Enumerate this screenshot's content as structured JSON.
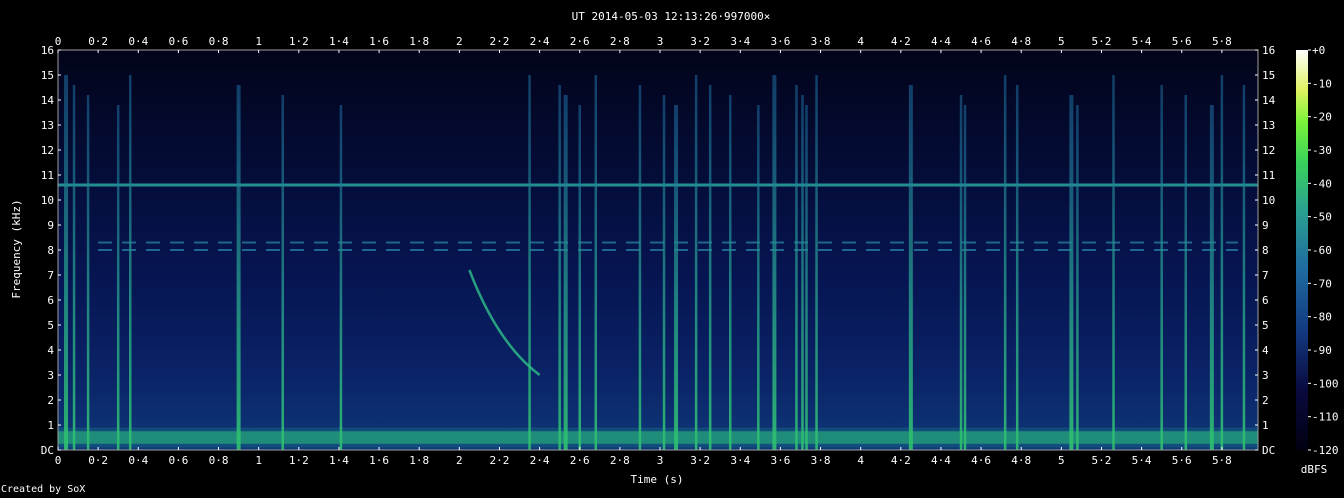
{
  "chart_data": {
    "type": "heatmap",
    "title": "UT 2014-05-03 12:13:26·997000×",
    "xlabel": "Time (s)",
    "ylabel": "Frequency (kHz)",
    "xlim": [
      0,
      5.98
    ],
    "ylim": [
      0,
      16
    ],
    "x_ticks": [
      "0",
      "0·2",
      "0·4",
      "0·6",
      "0·8",
      "1",
      "1·2",
      "1·4",
      "1·6",
      "1·8",
      "2",
      "2·2",
      "2·4",
      "2·6",
      "2·8",
      "3",
      "3·2",
      "3·4",
      "3·6",
      "3·8",
      "4",
      "4·2",
      "4·4",
      "4·6",
      "4·8",
      "5",
      "5·2",
      "5·4",
      "5·6",
      "5·8"
    ],
    "y_ticks": [
      "DC",
      "1",
      "2",
      "3",
      "4",
      "5",
      "6",
      "7",
      "8",
      "9",
      "10",
      "11",
      "12",
      "13",
      "14",
      "15",
      "16"
    ],
    "colorbar": {
      "label": "dBFS",
      "range": [
        -120,
        0
      ],
      "ticks": [
        "+0",
        "-10",
        "-20",
        "-30",
        "-40",
        "-50",
        "-60",
        "-70",
        "-80",
        "-90",
        "-100",
        "-110",
        "-120"
      ]
    },
    "features": {
      "steady_tone_khz": 10.6,
      "dashed_tones_khz": [
        8.3,
        8.0
      ],
      "low_band_khz": 0.5,
      "broadband_impulses_s": [
        0.04,
        0.08,
        0.15,
        0.3,
        0.36,
        0.9,
        1.12,
        1.41,
        2.35,
        2.5,
        2.53,
        2.6,
        2.68,
        2.9,
        3.02,
        3.08,
        3.18,
        3.25,
        3.35,
        3.49,
        3.57,
        3.68,
        3.71,
        3.73,
        3.78,
        4.25,
        4.5,
        4.52,
        4.72,
        4.78,
        5.05,
        5.08,
        5.26,
        5.5,
        5.62,
        5.75,
        5.8,
        5.91
      ],
      "chirp": {
        "start_s": 2.05,
        "end_s": 2.4,
        "start_khz": 7.2,
        "end_khz": 3.0
      }
    },
    "grid": false
  },
  "footer": {
    "credit": "Created by SoX"
  }
}
